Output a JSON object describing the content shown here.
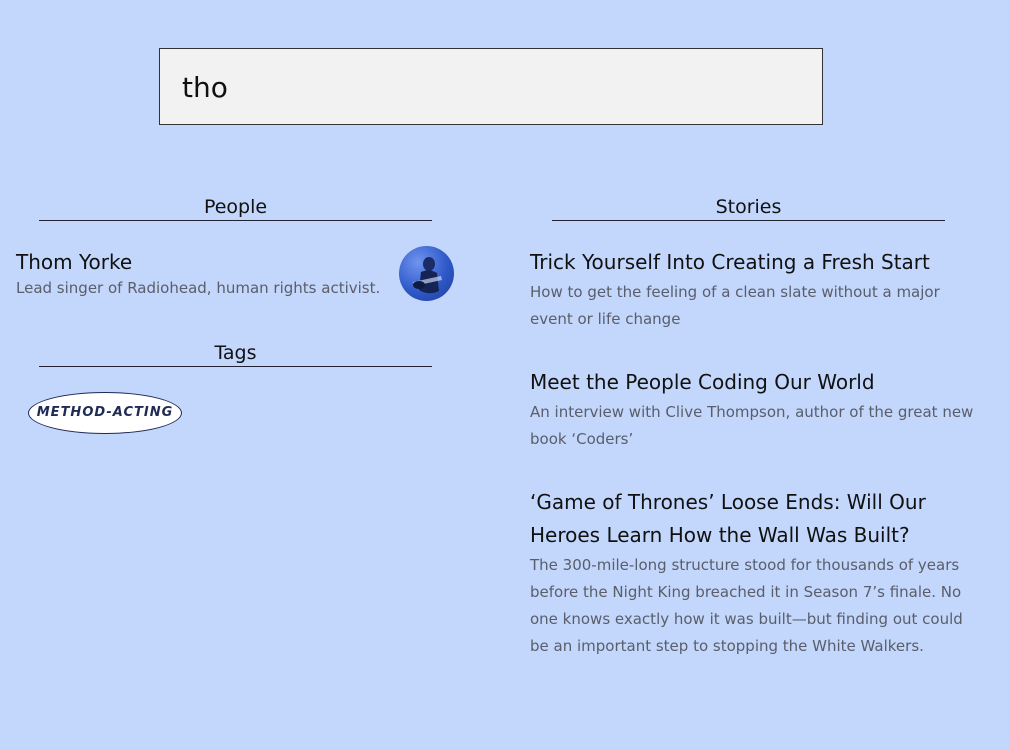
{
  "search": {
    "value": "tho"
  },
  "people_section": {
    "title": "People"
  },
  "people": [
    {
      "name": "Thom Yorke",
      "description": "Lead singer of Radiohead, human rights activist."
    }
  ],
  "tags_section": {
    "title": "Tags"
  },
  "tags": [
    {
      "label": "METHOD-ACTING"
    }
  ],
  "stories_section": {
    "title": "Stories"
  },
  "stories": [
    {
      "title": "Trick Yourself Into Creating a Fresh Start",
      "description": "How to get the feeling of a clean slate without a major event or life change"
    },
    {
      "title": "Meet the People Coding Our World",
      "description": "An interview with Clive Thompson, author of the great new book ‘Coders’"
    },
    {
      "title": "‘Game of Thrones’ Loose Ends: Will Our Heroes Learn How the Wall Was Built?",
      "description": "The 300-mile-long structure stood for thousands of years before the Night King breached it in Season 7’s finale. No one knows exactly how it was built—but finding out could be an important step to stopping the White Walkers."
    }
  ],
  "colors": {
    "background": "#c3d6fb",
    "search_bg": "#f2f2f2",
    "tag_border": "#1f2a55"
  }
}
